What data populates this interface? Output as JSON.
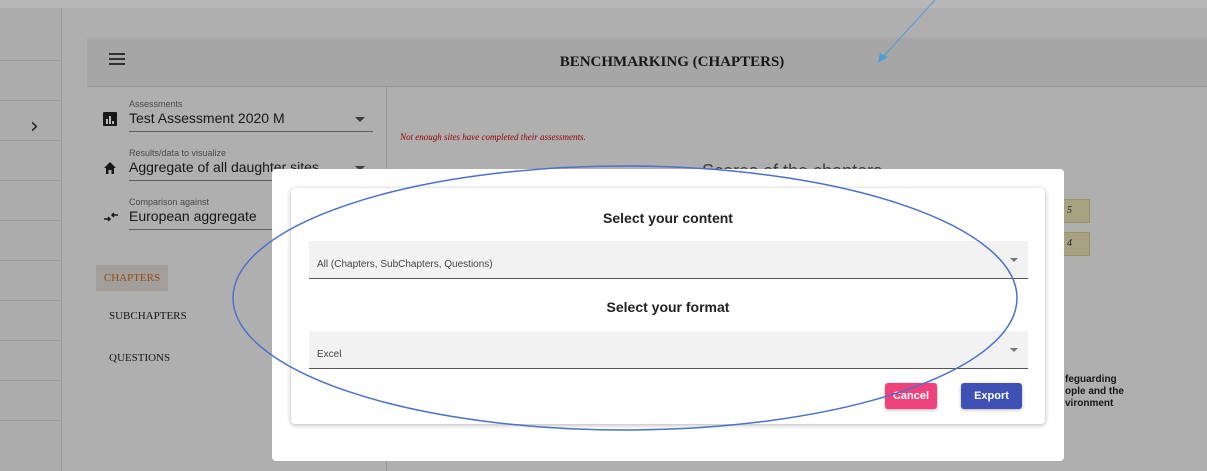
{
  "header": {
    "title": "BENCHMARKING (CHAPTERS)"
  },
  "filters": {
    "assessments": {
      "label": "Assessments",
      "value": "Test Assessment 2020 M"
    },
    "results": {
      "label": "Results/data to visualize",
      "value": "Aggregate of all daughter sites"
    },
    "comparison": {
      "label": "Comparison against",
      "value": "European aggregate"
    }
  },
  "nav": {
    "chapters": "CHAPTERS",
    "subchapters": "SUBCHAPTERS",
    "questions": "QUESTIONS"
  },
  "main": {
    "warning": "Not enough sites have completed their assessments.",
    "chart_heading": "Scores of the chapters",
    "score_a": "5",
    "score_b": "4",
    "legend_line1": "feguarding",
    "legend_line2": "ople and the",
    "legend_line3": "vironment"
  },
  "modal": {
    "content_heading": "Select your content",
    "content_value": "All (Chapters, SubChapters, Questions)",
    "format_heading": "Select your format",
    "format_value": "Excel",
    "cancel_label": "Cancel",
    "export_label": "Export"
  },
  "colors": {
    "cancel": "#f0417a",
    "export": "#3f51b5",
    "annotation": "#4a72c8",
    "warning": "#cc0000"
  },
  "icons": [
    "menu-icon",
    "chevron-right-icon",
    "bar-chart-icon",
    "home-icon",
    "compare-arrows-icon",
    "caret-down-icon"
  ]
}
